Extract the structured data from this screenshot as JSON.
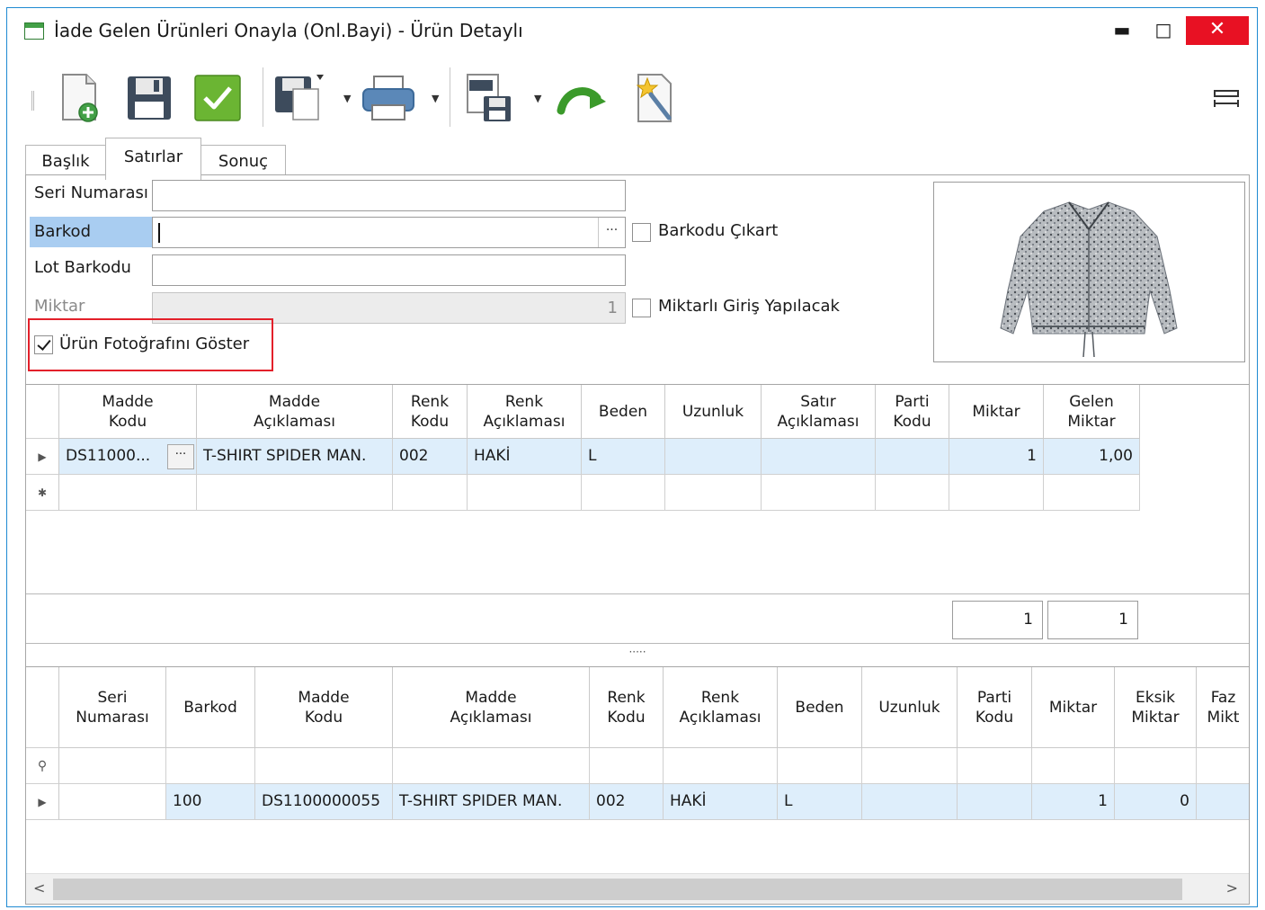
{
  "window": {
    "title": "İade Gelen Ürünleri Onayla (Onl.Bayi) - Ürün Detaylı",
    "minimize": "▬",
    "maximize": "□",
    "close": "✕"
  },
  "toolbar": {
    "buttons": [
      {
        "icon": "new-document-icon"
      },
      {
        "icon": "save-icon"
      },
      {
        "icon": "approve-check-icon"
      },
      {
        "icon": "save-as-icon"
      },
      {
        "icon": "print-icon"
      },
      {
        "icon": "export-txt-icon"
      },
      {
        "icon": "redo-arrow-icon"
      },
      {
        "icon": "wizard-icon"
      }
    ],
    "right_icon": "column-width-icon"
  },
  "tabs": [
    {
      "label": "Başlık"
    },
    {
      "label": "Satırlar",
      "active": true
    },
    {
      "label": "Sonuç"
    }
  ],
  "form": {
    "serial_label": "Seri Numarası",
    "serial_value": "",
    "barcode_label": "Barkod",
    "barcode_value": "",
    "barcode_button": "···",
    "remove_barcode_label": "Barkodu Çıkart",
    "lot_label": "Lot Barkodu",
    "lot_value": "",
    "qty_label": "Miktar",
    "qty_value": "1",
    "qty_entry_label": "Miktarlı Giriş Yapılacak",
    "show_photo_label": "Ürün Fotoğrafını Göster",
    "show_photo_checked": true
  },
  "top_grid": {
    "headers": [
      "Madde\nKodu",
      "Madde\nAçıklaması",
      "Renk\nKodu",
      "Renk\nAçıklaması",
      "Beden",
      "Uzunluk",
      "Satır\nAçıklaması",
      "Parti\nKodu",
      "Miktar",
      "Gelen\nMiktar"
    ],
    "rows": [
      {
        "madde_kodu": "DS11000...",
        "madde_aciklamasi": "T-SHIRT SPIDER MAN.",
        "renk_kodu": "002",
        "renk_aciklamasi": "HAKİ",
        "beden": "L",
        "uzunluk": "",
        "satir_aciklamasi": "",
        "parti_kodu": "",
        "miktar": "1",
        "gelen_miktar": "1,00"
      }
    ],
    "cell_button": "···",
    "new_row_marker": "✱",
    "footer": {
      "miktar_total": "1",
      "gelen_total": "1"
    }
  },
  "splitter": "·····",
  "bottom_grid": {
    "headers": [
      "Seri\nNumarası",
      "Barkod",
      "Madde\nKodu",
      "Madde\nAçıklaması",
      "Renk\nKodu",
      "Renk\nAçıklaması",
      "Beden",
      "Uzunluk",
      "Parti\nKodu",
      "Miktar",
      "Eksik\nMiktar",
      "Faz\nMikt"
    ],
    "filter_marker": "⚲",
    "rows": [
      {
        "seri_numarasi": "",
        "barkod": "100",
        "madde_kodu": "DS1100000055",
        "madde_aciklamasi": "T-SHIRT SPIDER MAN.",
        "renk_kodu": "002",
        "renk_aciklamasi": "HAKİ",
        "beden": "L",
        "uzunluk": "",
        "parti_kodu": "",
        "miktar": "1",
        "eksik_miktar": "0",
        "fazla_miktar": ""
      }
    ],
    "scroll_left": "<",
    "scroll_right": ">"
  },
  "colors": {
    "accent": "#1f8ad2",
    "selected_row": "#deeefb",
    "label_highlight": "#a9cdf1",
    "close_button": "#e81123",
    "highlight_box": "#e3202a"
  }
}
